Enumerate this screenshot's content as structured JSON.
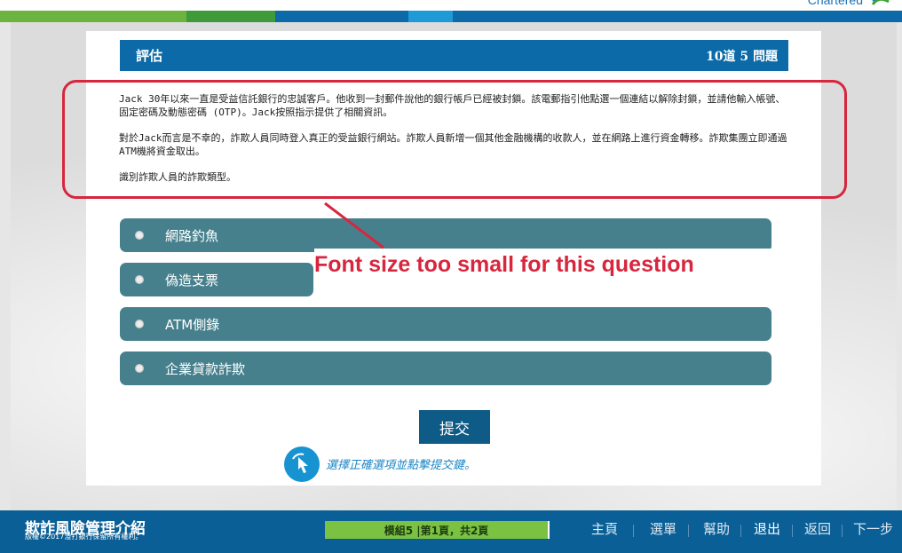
{
  "brand": {
    "logo_text": "Chartered"
  },
  "colors": {
    "strip": [
      "#6cb33f",
      "#3f9a3a",
      "#0b6aa7",
      "#1e9ad6",
      "#0b6aa7"
    ],
    "header": "#0b6aa7",
    "option": "#47808d",
    "annotation": "#d7263d",
    "footer": "#0a5f96",
    "progress": "#7bc242"
  },
  "question": {
    "section_title": "評估",
    "count": "10道 5  問題",
    "paragraphs": [
      "Jack 30年以來一直是受益信託銀行的忠誠客戶。他收到一封郵件說他的銀行帳戶已經被封鎖。該電郵指引他點選一個連結以解除封鎖，並請他輸入帳號、固定密碼及動態密碼 (OTP)。Jack按照指示提供了相關資訊。",
      "對於Jack而言是不幸的，詐欺人員同時登入真正的受益銀行網站。詐欺人員新增一個其他金融機構的收款人，並在網路上進行資金轉移。詐欺集團立即通過ATM機將資金取出。",
      "識別詐欺人員的詐欺類型。"
    ]
  },
  "annotation": {
    "text": "Font size too small for this question"
  },
  "options": [
    "網路釣魚",
    "偽造支票",
    "ATM側錄",
    "企業貸款詐欺"
  ],
  "submit_label": "提交",
  "hint": "選擇正確選項並點擊提交鍵。",
  "footer": {
    "title": "欺詐風險管理介紹",
    "copyright": "版權©2017渣打銀行保留所有權利。",
    "progress": "模組5 |第1頁，共2頁",
    "nav": [
      "主頁",
      "選單",
      "幫助",
      "退出",
      "返回",
      "下一步"
    ]
  }
}
